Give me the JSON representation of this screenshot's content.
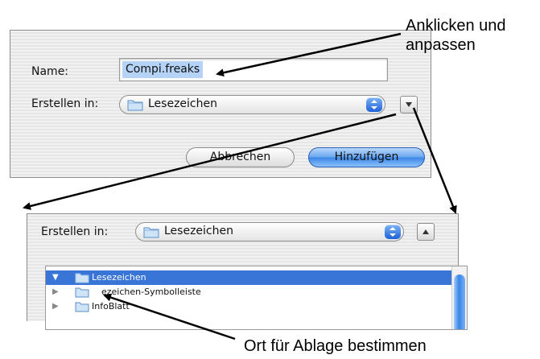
{
  "dialog": {
    "name_label": "Name:",
    "name_value": "Compi.freaks",
    "location_label": "Erstellen in:",
    "location_value": "Lesezeichen",
    "cancel_label": "Abbrechen",
    "add_label": "Hinzufügen",
    "expand_icon": "triangle-down-icon"
  },
  "expanded": {
    "location_label": "Erstellen in:",
    "location_value": "Lesezeichen",
    "collapse_icon": "triangle-up-icon",
    "tree": [
      {
        "label": "Lesezeichen",
        "expanded": true,
        "selected": true
      },
      {
        "label": "ezeichen-Symbolleiste",
        "expanded": false,
        "selected": false
      },
      {
        "label": "InfoBlatt",
        "expanded": false,
        "selected": false
      }
    ]
  },
  "annotations": {
    "top_line1": "Anklicken und",
    "top_line2": "anpassen",
    "bottom": "Ort für Ablage bestimmen"
  },
  "colors": {
    "selection": "#3875d7",
    "text_selection": "#b5d3f7",
    "default_button": "#3b86e6"
  }
}
